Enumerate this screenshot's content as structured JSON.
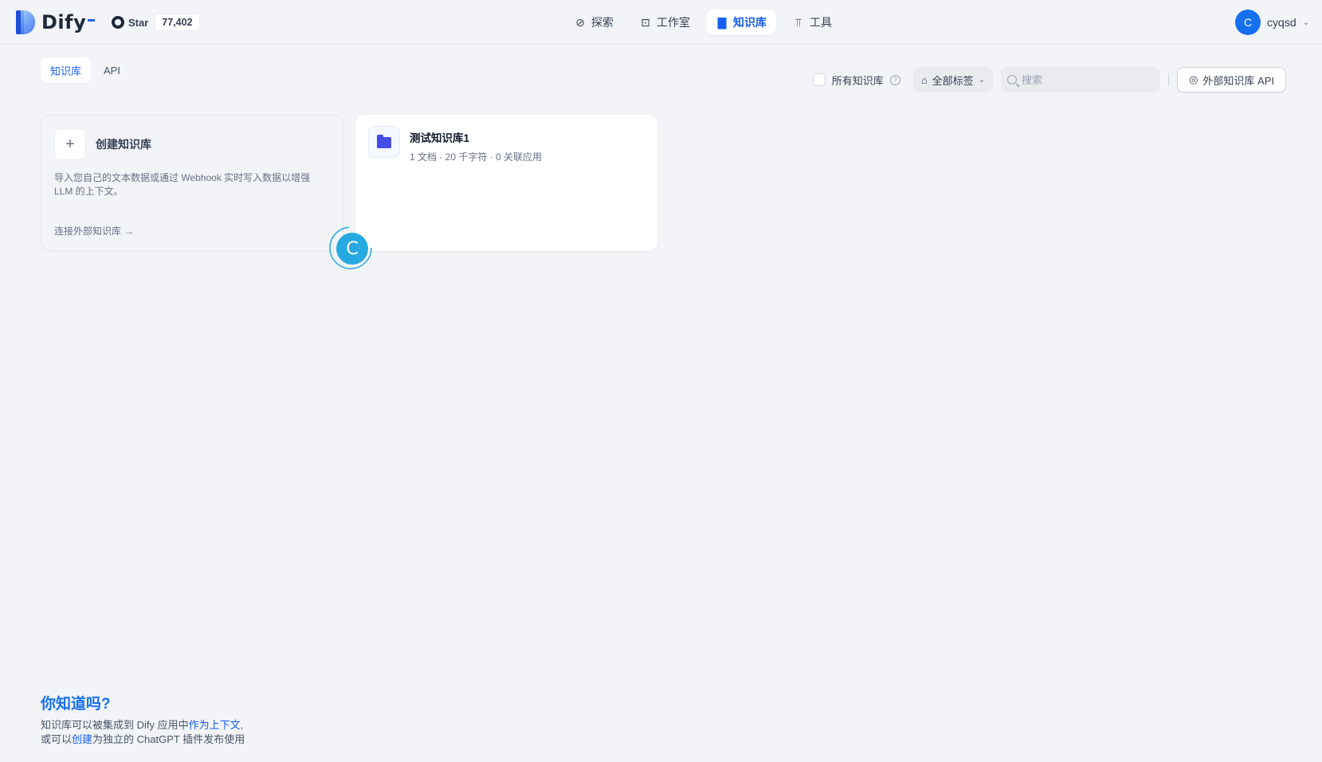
{
  "header": {
    "logo_text": "Dify",
    "github": {
      "star_label": "Star",
      "star_count": "77,402"
    },
    "nav": [
      {
        "label": "探索",
        "icon": "compass-icon",
        "active": false
      },
      {
        "label": "工作室",
        "icon": "robot-icon",
        "active": false
      },
      {
        "label": "知识库",
        "icon": "book-icon",
        "active": true
      },
      {
        "label": "工具",
        "icon": "hammer-icon",
        "active": false
      }
    ],
    "user": {
      "initial": "C",
      "name": "cyqsd"
    }
  },
  "subtabs": [
    {
      "label": "知识库",
      "active": true
    },
    {
      "label": "API",
      "active": false
    }
  ],
  "toolbar": {
    "all_datasets_label": "所有知识库",
    "tag_filter_label": "全部标签",
    "search_placeholder": "搜索",
    "external_api_label": "外部知识库 API"
  },
  "create_card": {
    "title": "创建知识库",
    "description": "导入您自己的文本数据或通过 Webhook 实时写入数据以增强 LLM 的上下文。",
    "connect_link": "连接外部知识库"
  },
  "datasets": [
    {
      "name": "测试知识库1",
      "meta": "1 文档 · 20 千字符 · 0 关联应用"
    }
  ],
  "cursor_letter": "C",
  "tip": {
    "title": "你知道吗?",
    "line1_prefix": "知识库可以被集成到 Dify 应用中",
    "line1_link": "作为上下文",
    "line1_suffix": ",",
    "line2_prefix": "或可以",
    "line2_link": "创建",
    "line2_suffix": "为独立的 ChatGPT 插件发布使用"
  },
  "colors": {
    "accent": "#155eef",
    "background": "#f2f4f7",
    "folder": "#444ce7"
  }
}
